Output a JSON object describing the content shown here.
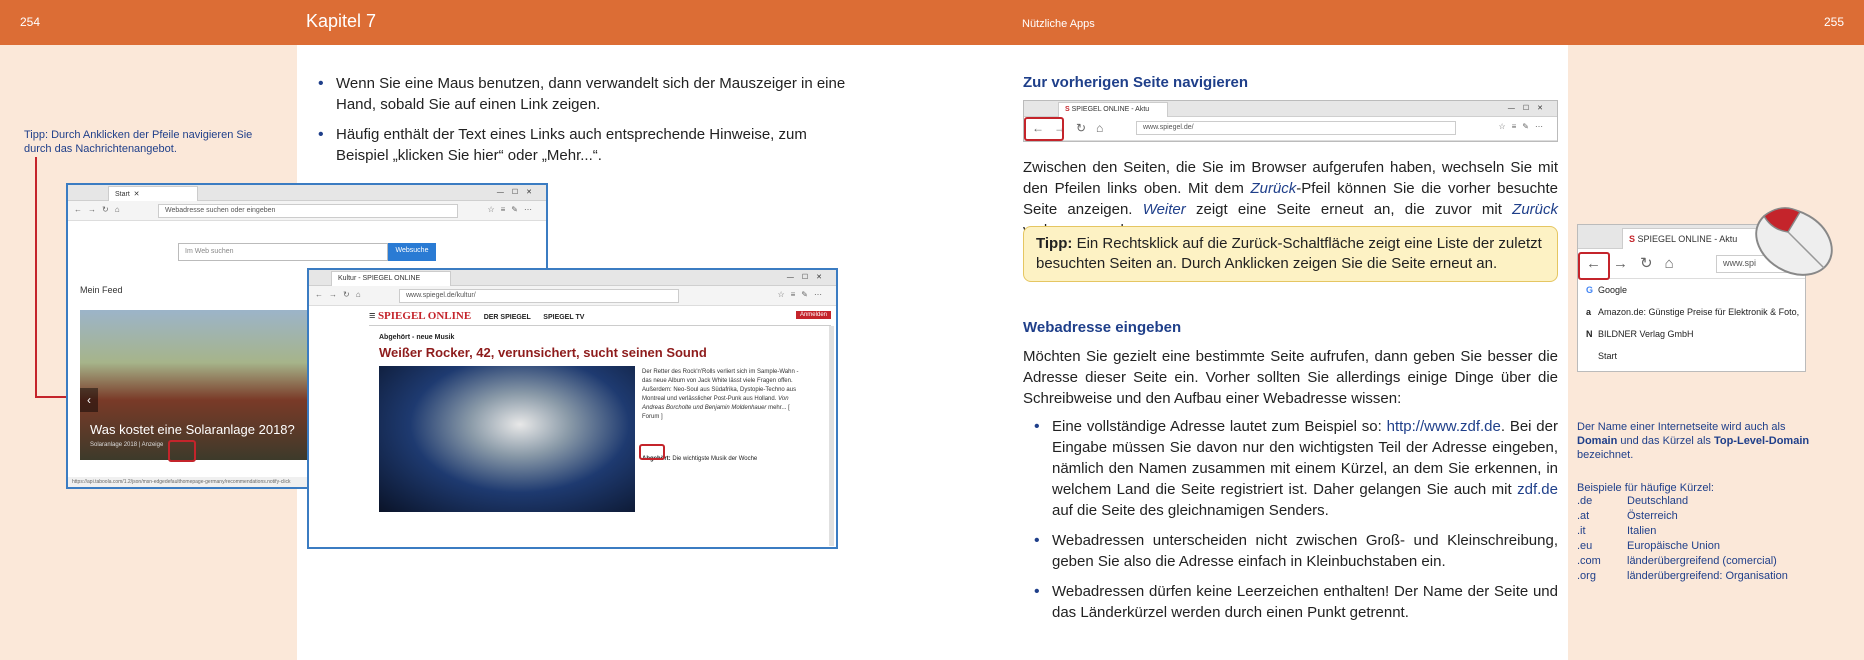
{
  "left_page": {
    "page_number": "254",
    "chapter": "Kapitel 7",
    "side_tip": "Tipp: Durch Anklicken der Pfeile navigieren Sie durch das Nachrichtenangebot.",
    "bullets": [
      "Wenn Sie eine Maus benutzen, dann verwandelt sich der Mauszeiger in eine Hand, sobald Sie auf einen Link zeigen.",
      "Häufig enthält der Text eines Links auch entsprechende Hinweise, zum Beispiel „klicken Sie hier“ oder „Mehr...“."
    ],
    "screenshot_start": {
      "tab_title": "Start",
      "address_placeholder": "Webadresse suchen oder eingeben",
      "search_placeholder": "Im Web suchen",
      "search_button": "Websuche",
      "feed_label": "Mein Feed",
      "headline": "Was kostet eine Solaranlage 2018?",
      "caption": "Solaranlage 2018 | Anzeige",
      "status_url": "https://api.taboola.com/1.2/json/msn-edgedefaulthomepage-germany/recommendations.notify-click"
    },
    "screenshot_spiegel": {
      "tab_title": "Kultur - SPIEGEL ONLINE",
      "url": "www.spiegel.de/kultur/",
      "logo": "SPIEGEL ONLINE",
      "nav_der_spiegel": "DER SPIEGEL",
      "nav_spiegel_tv": "SPIEGEL TV",
      "login": "Anmelden",
      "kicker": "Abgehört - neue Musik",
      "headline": "Weißer Rocker, 42, verunsichert, sucht seinen Sound",
      "teaser": "Der Retter des Rock'n'Rolls verliert sich im Sample-Wahn - das neue Album von Jack White lässt viele Fragen offen. Außerdem: Neo-Soul aus Südafrika, Dystopie-Techno aus Montreal und verlässlicher Post-Punk aus Holland.",
      "teaser_authors": "Von Andreas Borcholte und Benjamin Moldenhauer",
      "more_link": "mehr...",
      "forum": "[ Forum ]",
      "sub_kicker": "Abgehört:",
      "sub_text": "Die wichtigste Musik der Woche"
    }
  },
  "right_page": {
    "page_number": "255",
    "running_head": "Nützliche Apps",
    "section1_title": "Zur vorherigen Seite navigieren",
    "nav_shot": {
      "tab_title": "SPIEGEL ONLINE - Aktu",
      "url": "www.spiegel.de/"
    },
    "para1_parts": {
      "a": "Zwischen den Seiten, die Sie im Browser aufgerufen haben, wechseln Sie mit den Pfeilen links oben. Mit dem ",
      "b": "Zurück",
      "c": "-Pfeil können Sie die vorher besuchte Seite anzeigen. ",
      "d": "Weiter",
      "e": " zeigt eine Seite erneut an, die zuvor mit ",
      "f": "Zurück",
      "g": " verlassen wurde."
    },
    "tip_label": "Tipp:",
    "tip_text": "Ein Rechtsklick auf die Zurück-Schaltfläche zeigt eine Liste der zuletzt besuchten Seiten an. Durch Anklicken zeigen Sie die Seite erneut an.",
    "section2_title": "Webadresse eingeben",
    "para2": "Möchten Sie gezielt eine bestimmte Seite aufrufen, dann geben Sie besser die Adresse dieser Seite ein. Vorher sollten Sie allerdings einige Dinge über die Schreibweise und den Aufbau einer Webadresse wissen:",
    "bullet1_parts": {
      "a": "Eine vollständige Adresse lautet zum Beispiel so: ",
      "b": "http://www.zdf.de",
      "c": ". Bei der Eingabe müssen Sie davon nur den wichtigsten Teil der Adresse eingeben, nämlich den Namen zusammen mit einem Kürzel, an dem Sie erkennen, in welchem Land die Seite registriert ist. Daher gelangen Sie auch mit ",
      "d": "zdf.de",
      "e": " auf die Seite des gleichnamigen Senders."
    },
    "bullet2": "Webadressen unterscheiden nicht zwischen Groß- und Kleinschreibung, geben Sie also die Adresse einfach in Kleinbuchstaben ein.",
    "bullet3": "Webadressen dürfen keine Leerzeichen enthalten! Der Name der Seite und das Länderkürzel werden durch einen Punkt getrennt.",
    "history_shot": {
      "tab_title": "SPIEGEL ONLINE - Aktu",
      "url": "www.spi",
      "items": [
        {
          "icon": "G",
          "label": "Google"
        },
        {
          "icon": "a",
          "label": "Amazon.de: Günstige Preise für Elektronik & Foto,"
        },
        {
          "icon": "N",
          "label": "BILDNER Verlag GmbH"
        },
        {
          "icon": "",
          "label": "Start"
        }
      ]
    },
    "side_domain_parts": {
      "a": "Der Name einer Internetseite wird auch als ",
      "b": "Domain",
      "c": " und das Kürzel als ",
      "d": "Top-Level-Domain",
      "e": " bezeichnet."
    },
    "side_examples_title": "Beispiele für häufige Kürzel:",
    "tlds": [
      {
        "code": ".de",
        "desc": "Deutschland"
      },
      {
        "code": ".at",
        "desc": "Österreich"
      },
      {
        "code": ".it",
        "desc": "Italien"
      },
      {
        "code": ".eu",
        "desc": "Europäische Union"
      },
      {
        "code": ".com",
        "desc": "länderübergreifend (comercial)"
      },
      {
        "code": ".org",
        "desc": "länderübergreifend: Organisation"
      }
    ]
  },
  "colors": {
    "header": "#dc6d35",
    "margin": "#fbe8d9",
    "accent": "#1f3f8a",
    "highlight": "#c4242b",
    "tip_bg": "#fdf2c4"
  }
}
